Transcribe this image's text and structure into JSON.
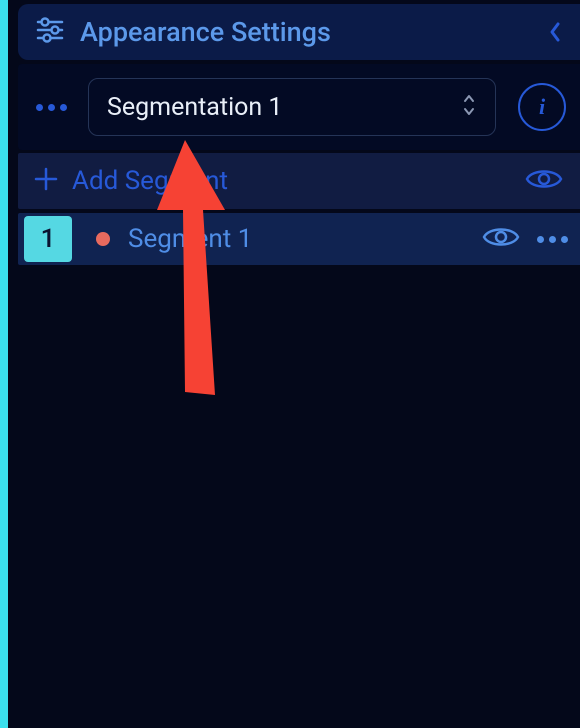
{
  "header": {
    "title": "Appearance Settings"
  },
  "selector": {
    "selected": "Segmentation 1"
  },
  "actions": {
    "add_label": "Add Segment"
  },
  "segments": [
    {
      "badge": "1",
      "name": "Segment 1",
      "color": "#e86a5e"
    }
  ]
}
